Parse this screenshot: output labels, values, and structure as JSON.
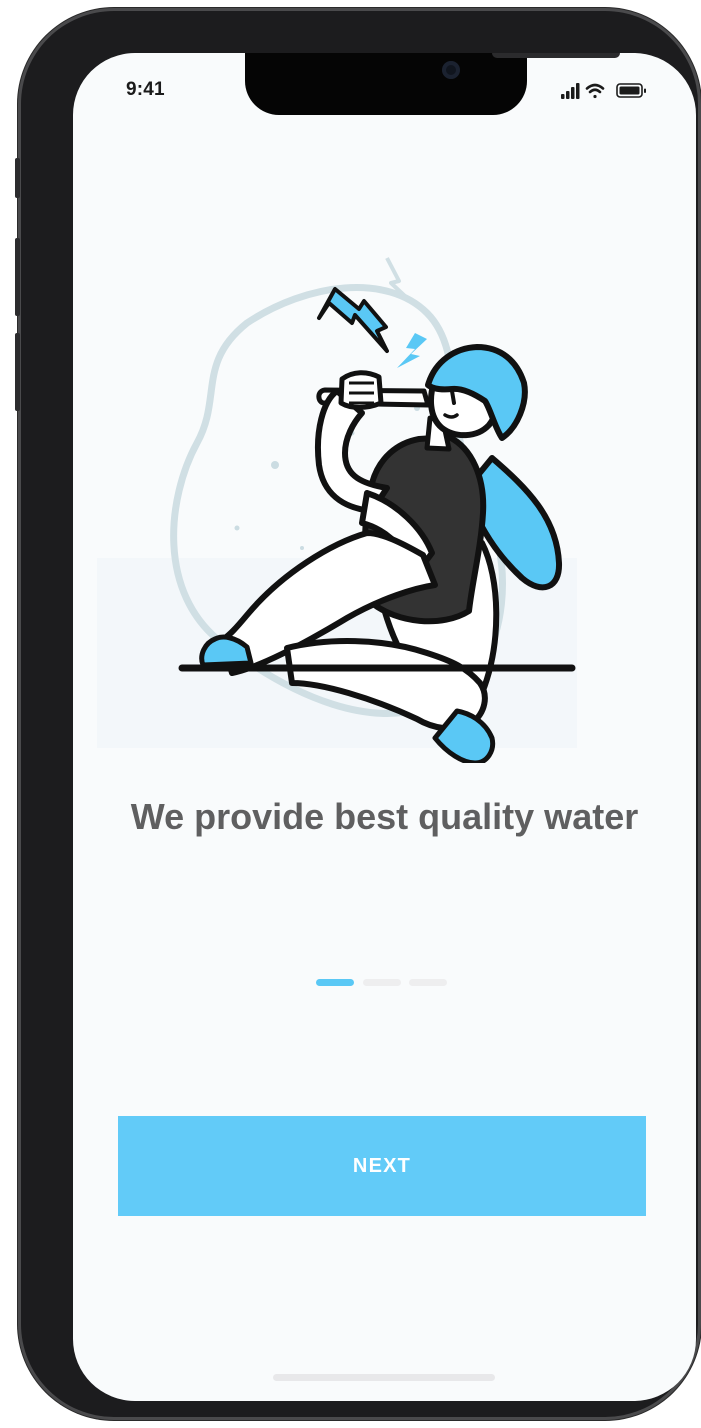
{
  "status_bar": {
    "time": "9:41",
    "icons": [
      "cellular-signal-icon",
      "wifi-icon",
      "battery-icon"
    ]
  },
  "onboarding": {
    "illustration": "person-drinking-water-illustration",
    "title": "We provide best quality water",
    "pagination": {
      "total": 3,
      "current": 1
    },
    "next_label": "NEXT"
  },
  "colors": {
    "accent": "#62cbf8",
    "title": "#5f5f60",
    "dot_inactive": "#eeeeef",
    "background": "#f9fbfc"
  }
}
